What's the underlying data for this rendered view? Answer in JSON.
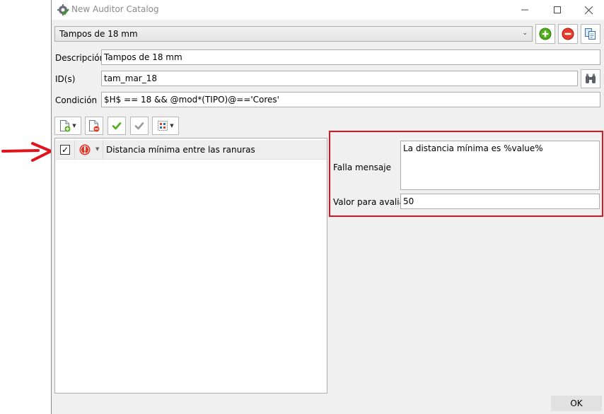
{
  "window": {
    "title": "New Auditor Catalog"
  },
  "catalog": {
    "selected": "Tampos de 18 mm"
  },
  "fields": {
    "descripcion_label": "Descripción",
    "descripcion_value": "Tampos de 18 mm",
    "ids_label": "ID(s)",
    "ids_value": "tam_mar_18",
    "condicion_label": "Condición",
    "condicion_value": "$H$ == 18 && @mod*(TIPO)@=='Cores'"
  },
  "rules": [
    {
      "checked": true,
      "label": "Distancia mínima entre las ranuras"
    }
  ],
  "details": {
    "falla_label": "Falla mensaje",
    "falla_value": "La distancia mínima es %value%",
    "valor_label": "Valor para avaliar",
    "valor_value": "50"
  },
  "buttons": {
    "ok": "OK"
  },
  "colors": {
    "highlight": "#e0141c",
    "add": "#4caf14",
    "remove": "#e53b2a",
    "alert": "#e0342a"
  }
}
